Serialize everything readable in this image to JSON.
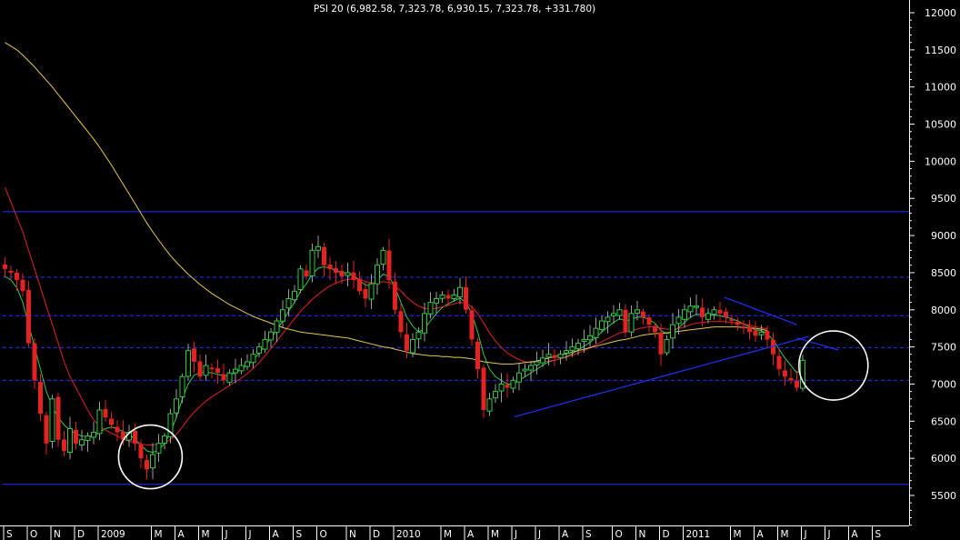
{
  "chart_data": {
    "type": "candlestick",
    "title": "PSI 20 (6,982.58, 7,323.78, 6,930.15, 7,323.78, +331.780)",
    "ylim": [
      5400,
      12200
    ],
    "y_ticks": [
      12000,
      11500,
      11000,
      10500,
      10000,
      9500,
      9000,
      8500,
      8000,
      7500,
      7000,
      6500,
      6000,
      5500
    ],
    "x_range": [
      0,
      151
    ],
    "x_ticks": [
      {
        "label": "S",
        "i": 0
      },
      {
        "label": "O",
        "i": 4
      },
      {
        "label": "N",
        "i": 8
      },
      {
        "label": "D",
        "i": 12
      },
      {
        "label": "2009",
        "i": 16
      },
      {
        "label": "M",
        "i": 25
      },
      {
        "label": "A",
        "i": 29
      },
      {
        "label": "M",
        "i": 33
      },
      {
        "label": "J",
        "i": 37
      },
      {
        "label": "J",
        "i": 41
      },
      {
        "label": "A",
        "i": 45
      },
      {
        "label": "S",
        "i": 49
      },
      {
        "label": "O",
        "i": 53
      },
      {
        "label": "N",
        "i": 58
      },
      {
        "label": "D",
        "i": 62
      },
      {
        "label": "2010",
        "i": 66
      },
      {
        "label": "M",
        "i": 74
      },
      {
        "label": "A",
        "i": 78
      },
      {
        "label": "M",
        "i": 82
      },
      {
        "label": "J",
        "i": 86
      },
      {
        "label": "J",
        "i": 90
      },
      {
        "label": "A",
        "i": 94
      },
      {
        "label": "S",
        "i": 98
      },
      {
        "label": "O",
        "i": 103
      },
      {
        "label": "N",
        "i": 107
      },
      {
        "label": "D",
        "i": 111
      },
      {
        "label": "2011",
        "i": 115
      },
      {
        "label": "M",
        "i": 123
      },
      {
        "label": "A",
        "i": 127
      },
      {
        "label": "M",
        "i": 131
      },
      {
        "label": "J",
        "i": 135
      },
      {
        "label": "J",
        "i": 139
      },
      {
        "label": "A",
        "i": 143
      },
      {
        "label": "S",
        "i": 147
      }
    ],
    "closes": [
      8550,
      8500,
      8400,
      8250,
      7550,
      7050,
      6600,
      6200,
      6800,
      6250,
      6100,
      6400,
      6200,
      6250,
      6300,
      6350,
      6650,
      6550,
      6450,
      6350,
      6250,
      6350,
      6200,
      6000,
      5850,
      6050,
      6200,
      6300,
      6600,
      6800,
      7100,
      7450,
      7300,
      7100,
      7250,
      7200,
      7150,
      7050,
      7150,
      7200,
      7250,
      7300,
      7400,
      7500,
      7600,
      7700,
      7850,
      8000,
      8150,
      8250,
      8550,
      8450,
      8800,
      8850,
      8600,
      8550,
      8500,
      8450,
      8500,
      8400,
      8250,
      8150,
      8350,
      8600,
      8800,
      8400,
      8000,
      7700,
      7450,
      7600,
      7700,
      7950,
      8100,
      8150,
      8200,
      8150,
      8200,
      8300,
      8000,
      7600,
      7200,
      6650,
      6800,
      6900,
      7000,
      6950,
      7050,
      7150,
      7200,
      7250,
      7300,
      7350,
      7400,
      7350,
      7400,
      7450,
      7500,
      7550,
      7600,
      7650,
      7750,
      7850,
      7900,
      7950,
      8000,
      7700,
      7950,
      8000,
      7900,
      7800,
      7700,
      7400,
      7600,
      7800,
      7900,
      8000,
      8050,
      8050,
      7900,
      7950,
      8000,
      7950,
      7900,
      7850,
      7800,
      7750,
      7700,
      7650,
      7700,
      7600,
      7400,
      7200,
      7100,
      7050,
      6950,
      7320
    ],
    "series": [
      {
        "values": [
          8450,
          8400,
          8300,
          8100,
          7800,
          7500,
          7200,
          6900,
          6700,
          6550,
          6450,
          6380,
          6330,
          6300,
          6290,
          6300,
          6350,
          6400,
          6420,
          6400,
          6360,
          6320,
          6260,
          6180,
          6100,
          6080,
          6110,
          6200,
          6350,
          6550,
          6800,
          7000,
          7120,
          7150,
          7160,
          7150,
          7130,
          7110,
          7120,
          7150,
          7200,
          7250,
          7320,
          7420,
          7520,
          7620,
          7730,
          7850,
          7980,
          8100,
          8250,
          8350,
          8480,
          8560,
          8580,
          8560,
          8530,
          8500,
          8490,
          8460,
          8400,
          8330,
          8330,
          8400,
          8480,
          8450,
          8300,
          8100,
          7900,
          7780,
          7700,
          7750,
          7850,
          7950,
          8030,
          8080,
          8120,
          8160,
          8100,
          7950,
          7700,
          7400,
          7200,
          7100,
          7050,
          7000,
          7000,
          7050,
          7100,
          7150,
          7200,
          7250,
          7300,
          7320,
          7340,
          7370,
          7410,
          7460,
          7510,
          7560,
          7630,
          7700,
          7770,
          7830,
          7880,
          7850,
          7870,
          7900,
          7900,
          7870,
          7820,
          7720,
          7680,
          7710,
          7760,
          7830,
          7900,
          7940,
          7940,
          7930,
          7930,
          7920,
          7900,
          7880,
          7850,
          7810,
          7770,
          7730,
          7720,
          7680,
          7590,
          7470,
          7350,
          7250,
          7150,
          7200
        ],
        "color": "#2ecc40"
      },
      {
        "values": [
          9650,
          9450,
          9250,
          9050,
          8800,
          8550,
          8300,
          8050,
          7800,
          7550,
          7300,
          7100,
          6950,
          6800,
          6650,
          6520,
          6430,
          6380,
          6340,
          6300,
          6260,
          6230,
          6210,
          6190,
          6180,
          6180,
          6190,
          6210,
          6250,
          6320,
          6420,
          6530,
          6620,
          6700,
          6770,
          6830,
          6880,
          6930,
          6980,
          7030,
          7080,
          7140,
          7210,
          7290,
          7380,
          7480,
          7580,
          7680,
          7780,
          7880,
          7980,
          8060,
          8140,
          8210,
          8270,
          8320,
          8360,
          8390,
          8410,
          8420,
          8410,
          8380,
          8360,
          8360,
          8380,
          8370,
          8320,
          8250,
          8170,
          8100,
          8050,
          8020,
          8010,
          8020,
          8040,
          8060,
          8080,
          8100,
          8090,
          8040,
          7950,
          7820,
          7690,
          7580,
          7490,
          7420,
          7370,
          7330,
          7300,
          7290,
          7290,
          7300,
          7310,
          7320,
          7340,
          7360,
          7390,
          7420,
          7450,
          7490,
          7530,
          7570,
          7610,
          7650,
          7690,
          7700,
          7720,
          7740,
          7760,
          7770,
          7770,
          7750,
          7740,
          7740,
          7750,
          7770,
          7800,
          7820,
          7830,
          7840,
          7840,
          7840,
          7840,
          7830,
          7820,
          7810,
          7790,
          7770,
          7760,
          7740
        ],
        "color": "#e52222"
      },
      {
        "values": [
          11600,
          11550,
          11500,
          11430,
          11350,
          11270,
          11180,
          11090,
          11000,
          10900,
          10800,
          10700,
          10600,
          10500,
          10400,
          10300,
          10190,
          10070,
          9950,
          9820,
          9690,
          9560,
          9430,
          9300,
          9170,
          9050,
          8940,
          8830,
          8730,
          8640,
          8560,
          8480,
          8410,
          8340,
          8280,
          8220,
          8170,
          8120,
          8070,
          8030,
          7990,
          7950,
          7910,
          7880,
          7850,
          7820,
          7790,
          7760,
          7740,
          7720,
          7700,
          7690,
          7680,
          7670,
          7660,
          7650,
          7640,
          7630,
          7620,
          7600,
          7580,
          7560,
          7540,
          7520,
          7500,
          7490,
          7470,
          7450,
          7430,
          7410,
          7400,
          7390,
          7380,
          7380,
          7370,
          7370,
          7360,
          7360,
          7350,
          7340,
          7320,
          7300,
          7290,
          7280,
          7270,
          7270,
          7270,
          7280,
          7290,
          7300,
          7310,
          7330,
          7350,
          7370,
          7390,
          7410,
          7430,
          7450,
          7470,
          7490,
          7510,
          7530,
          7550,
          7570,
          7590,
          7600,
          7620,
          7640,
          7660,
          7670,
          7680,
          7680,
          7690,
          7700,
          7710,
          7720,
          7730,
          7740,
          7750,
          7760,
          7770,
          7770,
          7770,
          7770,
          7770,
          7760,
          7760,
          7750,
          7740,
          7720
        ],
        "color": "#e8c84a"
      }
    ],
    "horizontal_lines": [
      {
        "y": 9320,
        "style": "solid",
        "color": "#2030ff"
      },
      {
        "y": 8440,
        "style": "dashed",
        "color": "#2030ff"
      },
      {
        "y": 7920,
        "style": "dashed",
        "color": "#2030ff"
      },
      {
        "y": 7490,
        "style": "dashed",
        "color": "#2030ff"
      },
      {
        "y": 7050,
        "style": "dashed",
        "color": "#2030ff"
      },
      {
        "y": 5650,
        "style": "solid",
        "color": "#2030ff"
      }
    ],
    "trendlines": [
      {
        "i1": 86.2,
        "y1": 6560,
        "i2": 136,
        "y2": 7640,
        "color": "#2030ff"
      },
      {
        "i1": 121.7,
        "y1": 8170,
        "i2": 134,
        "y2": 7800,
        "color": "#2030ff"
      },
      {
        "i1": 134,
        "y1": 7620,
        "i2": 141,
        "y2": 7460,
        "color": "#2030ff"
      }
    ],
    "circles": [
      {
        "i": 24.6,
        "y": 6020,
        "r": 35
      },
      {
        "i": 140.2,
        "y": 7250,
        "r": 38
      }
    ],
    "colors": {
      "up": "#2ecc40",
      "down": "#e52222",
      "background": "#000000",
      "text": "#ffffff",
      "circle": "#ffffff"
    },
    "grid": false,
    "legend": "none"
  }
}
